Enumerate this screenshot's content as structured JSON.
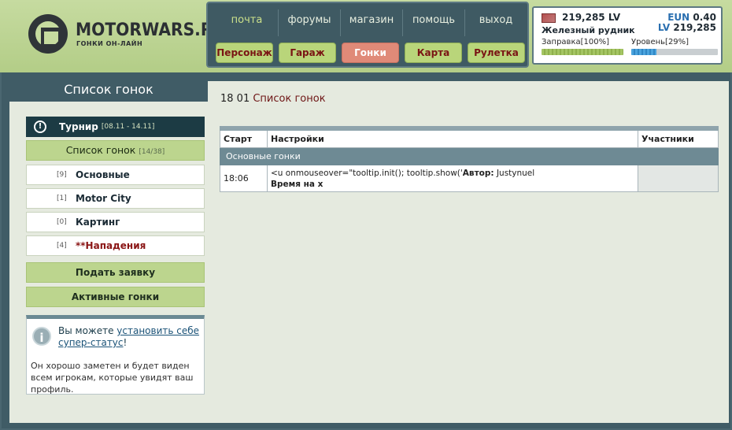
{
  "logo": {
    "title": "MOTORWARS.RU",
    "subtitle": "ГОНКИ ОН-ЛАЙН"
  },
  "top_nav": [
    {
      "label": "почта",
      "active": true
    },
    {
      "label": "форумы",
      "active": false
    },
    {
      "label": "магазин",
      "active": false
    },
    {
      "label": "помощь",
      "active": false
    },
    {
      "label": "выход",
      "active": false
    }
  ],
  "sub_nav": [
    {
      "label": "Персонаж",
      "active": false
    },
    {
      "label": "Гараж",
      "active": false
    },
    {
      "label": "Гонки",
      "active": true
    },
    {
      "label": "Карта",
      "active": false
    },
    {
      "label": "Рулетка",
      "active": false
    }
  ],
  "stats": {
    "money": "219,285 LV",
    "location": "Железный рудник",
    "eun_key": "EUN",
    "eun_value": "0.40",
    "lv_key": "LV",
    "lv_value": "219,285",
    "fuel_label": "Заправка[100%]",
    "fuel_percent": 100,
    "level_label": "Уровень[29%]",
    "level_percent": 29
  },
  "sidebar": {
    "title": "Список гонок",
    "tournament": {
      "label": "Турнир",
      "dates": "[08.11 - 14.11]",
      "icon": "alert-clock-icon"
    },
    "list_title": {
      "label": "Список гонок",
      "count": "[14/38]"
    },
    "categories": [
      {
        "num": "[9]",
        "label": "Основные"
      },
      {
        "num": "[1]",
        "label": "Motor City"
      },
      {
        "num": "[0]",
        "label": "Картинг"
      },
      {
        "num": "[4]",
        "label": "**Нападения"
      }
    ],
    "apply_button": "Подать заявку",
    "active_races_button": "Активные гонки",
    "info": {
      "icon": "info-icon",
      "text_prefix": "Вы можете ",
      "link": "установить себе супер-статус",
      "text_suffix": "!",
      "body": "Он хорошо заметен и будет виден всем игрокам, которые увидят ваш профиль."
    }
  },
  "content": {
    "title_date": "18 01",
    "title_text": "Список гонок",
    "table": {
      "headers": [
        "Старт",
        "Настройки",
        "Участники"
      ],
      "group": "Основные гонки",
      "rows": [
        {
          "start": "18:06",
          "settings_code": "<u onmouseover=\"tooltip.init(); tooltip.show('",
          "author_key": "Автор:",
          "author_value": "Justynuel",
          "settings_line2": "Время на х",
          "participants": ""
        }
      ]
    }
  }
}
